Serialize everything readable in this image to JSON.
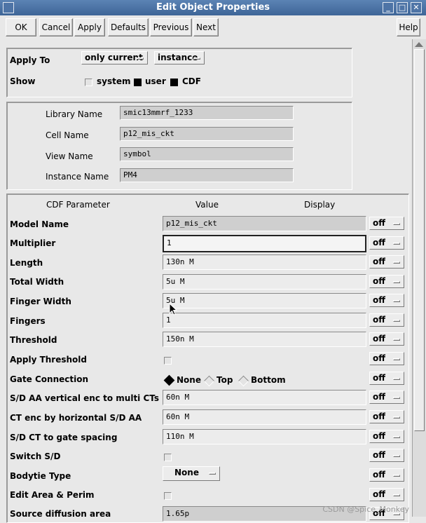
{
  "window": {
    "title": "Edit Object Properties",
    "controls": [
      "_",
      "□",
      "✕"
    ]
  },
  "toolbar": {
    "ok": "OK",
    "cancel": "Cancel",
    "apply": "Apply",
    "defaults": "Defaults",
    "previous": "Previous",
    "next": "Next",
    "help": "Help"
  },
  "apply_section": {
    "apply_to_label": "Apply To",
    "apply_to_value": "only current",
    "apply_to_target": "instance",
    "show_label": "Show",
    "show_options": [
      {
        "label": "system",
        "checked": false
      },
      {
        "label": "user",
        "checked": true
      },
      {
        "label": "CDF",
        "checked": true
      }
    ]
  },
  "info_section": {
    "library_label": "Library Name",
    "library_value": "smic13mmrf_1233",
    "cell_label": "Cell Name",
    "cell_value": "p12_mis_ckt",
    "view_label": "View Name",
    "view_value": "symbol",
    "instance_label": "Instance Name",
    "instance_value": "PM4"
  },
  "cdf": {
    "headers": {
      "param": "CDF Parameter",
      "value": "Value",
      "display": "Display"
    },
    "display_value": "off",
    "rows": [
      {
        "label": "Model Name",
        "value": "p12_mis_ckt"
      },
      {
        "label": "Multiplier",
        "value": "1"
      },
      {
        "label": "Length",
        "value": "130n M"
      },
      {
        "label": "Total Width",
        "value": "5u M"
      },
      {
        "label": "Finger Width",
        "value": "5u M"
      },
      {
        "label": "Fingers",
        "value": "1"
      },
      {
        "label": "Threshold",
        "value": "150n M"
      },
      {
        "label": "Apply Threshold",
        "value": ""
      },
      {
        "label": "Gate Connection",
        "value": ""
      },
      {
        "label": "S/D AA vertical enc to multi CTs",
        "value": "60n M"
      },
      {
        "label": "CT enc by horizontal S/D AA",
        "value": "60n M"
      },
      {
        "label": "S/D CT to gate spacing",
        "value": "110n M"
      },
      {
        "label": "Switch S/D",
        "value": ""
      },
      {
        "label": "Bodytie Type",
        "value": "None"
      },
      {
        "label": "Edit Area & Perim",
        "value": ""
      },
      {
        "label": "Source diffusion area",
        "value": "1.65p"
      }
    ],
    "gate_options": [
      {
        "label": "None",
        "selected": true
      },
      {
        "label": "Top",
        "selected": false
      },
      {
        "label": "Bottom",
        "selected": false
      }
    ]
  },
  "watermark": "CSDN @Spice_Monkey"
}
